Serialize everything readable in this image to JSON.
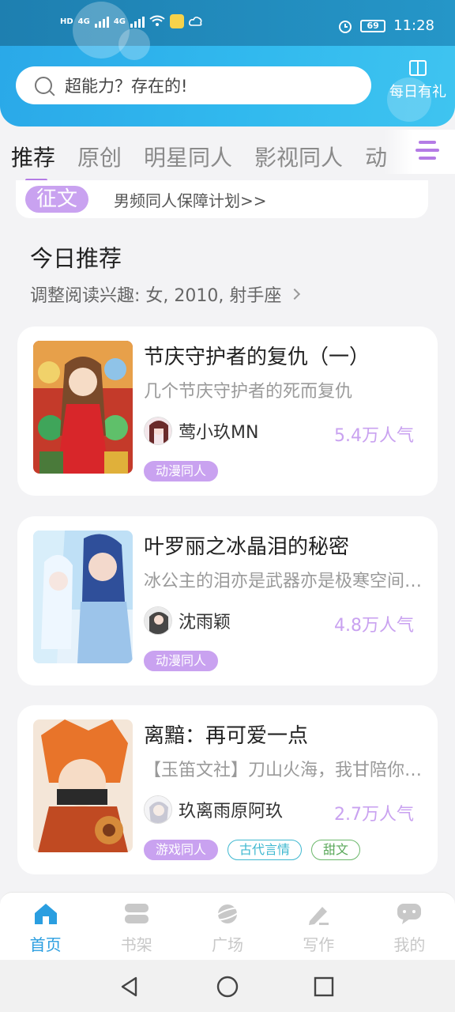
{
  "status_bar": {
    "time": "11:28",
    "battery": "69",
    "network_1": "4G",
    "network_2": "4G",
    "hd_1": "HD",
    "hd_2": "HD"
  },
  "header": {
    "search_placeholder": "超能力？存在的!",
    "daily_gift_label": "每日有礼",
    "accent_color": "#2fb2ea"
  },
  "tabs": [
    {
      "label": "推荐",
      "active": true
    },
    {
      "label": "原创",
      "active": false
    },
    {
      "label": "明星同人",
      "active": false
    },
    {
      "label": "影视同人",
      "active": false
    },
    {
      "label": "动",
      "active": false
    }
  ],
  "banner": {
    "badge": "征文",
    "text": "男频同人保障计划>>"
  },
  "section": {
    "title": "今日推荐",
    "subtitle": "调整阅读兴趣: 女, 2010, 射手座"
  },
  "cards": [
    {
      "title": "节庆守护者的复仇（一）",
      "desc": "几个节庆守护者的死而复仇",
      "author": "莺小玖MN",
      "popularity": "5.4万人气",
      "tags": [
        {
          "label": "动漫同人",
          "style": "purple"
        }
      ]
    },
    {
      "title": "叶罗丽之冰晶泪的秘密",
      "desc": "冰公主的泪亦是武器亦是极寒空间的钥匙",
      "author": "沈雨颖",
      "popularity": "4.8万人气",
      "tags": [
        {
          "label": "动漫同人",
          "style": "purple"
        }
      ]
    },
    {
      "title": "离黯：再可爱一点",
      "desc": "【玉笛文社】刀山火海，我甘陪你一起",
      "author": "玖离雨原阿玖",
      "popularity": "2.7万人气",
      "tags": [
        {
          "label": "游戏同人",
          "style": "purple"
        },
        {
          "label": "古代言情",
          "style": "teal"
        },
        {
          "label": "甜文",
          "style": "green"
        }
      ]
    }
  ],
  "bottom_nav": [
    {
      "label": "首页",
      "icon": "home-icon",
      "active": true
    },
    {
      "label": "书架",
      "icon": "bookshelf-icon",
      "active": false
    },
    {
      "label": "广场",
      "icon": "planet-icon",
      "active": false
    },
    {
      "label": "写作",
      "icon": "pen-icon",
      "active": false
    },
    {
      "label": "我的",
      "icon": "chat-bubble-icon",
      "active": false
    }
  ]
}
